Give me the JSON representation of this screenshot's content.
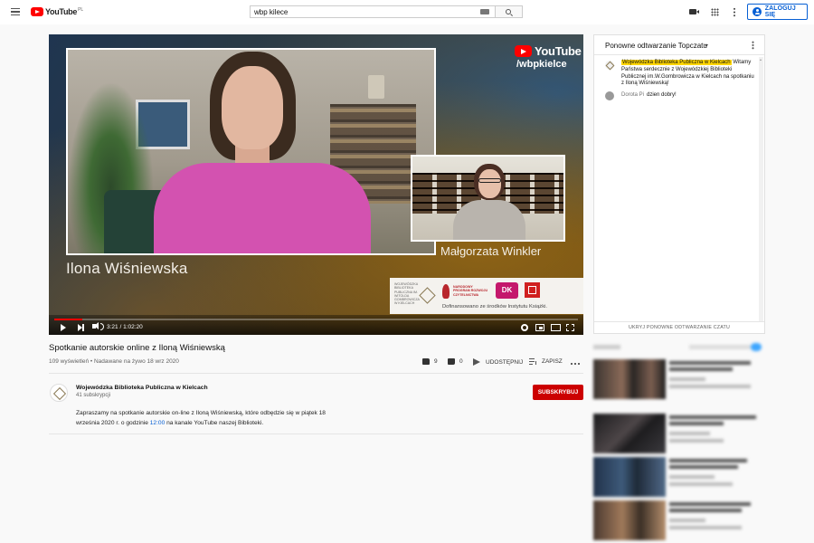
{
  "masthead": {
    "logo_text": "YouTube",
    "logo_region": "PL",
    "search_value": "wbp kilece",
    "signin_label": "ZALOGUJ SIĘ"
  },
  "player": {
    "overlay_brand": "YouTube",
    "overlay_handle": "/wbpkielce",
    "speaker_main": "Ilona Wiśniewska",
    "speaker_inset": "Małgorzata Winkler",
    "sponsor_wbp_text": "WOJEWÓDZKA BIBLIOTEKA PUBLICZNA IM. WITOLDA GOMBROWICZA W KIELCACH",
    "sponsor_npr_text": "NARODOWY PROGRAM ROZWOJU CZYTELNICTWA",
    "sponsor_dk_text": "DK",
    "sponsor_caption": "Dofinansowano ze środków Instytutu Książki.",
    "time_display": "3:21 / 1:02:20",
    "progress_fraction": 0.054
  },
  "video": {
    "title": "Spotkanie autorskie online z Iloną Wiśniewską",
    "meta": "109 wyświetleń • Nadawane na żywo 18 wrz 2020",
    "likes": "9",
    "dislikes": "0",
    "share_label": "UDOSTĘPNIJ",
    "save_label": "ZAPISZ"
  },
  "channel": {
    "name": "Wojewódzka Biblioteka Publiczna w Kielcach",
    "subs": "41 subskrypcji",
    "subscribe_label": "SUBSKRYBUJ",
    "description_before": "Zapraszamy na spotkanie autorskie on-line z Iloną Wiśniewską, które odbędzie się w piątek 18 września 2020 r. o godzinie ",
    "description_link": "12:00",
    "description_after": " na kanale YouTube naszej Biblioteki."
  },
  "chat": {
    "title": "Ponowne odtwarzanie Topczatu",
    "messages": [
      {
        "author": "Wojewódzka Biblioteka Publiczna w Kielcach",
        "text": "Witamy Państwa serdecznie z Wojewódzkiej Biblioteki Publicznej im.W.Gombrowicza w Kielcach na spotkaniu z Iloną Wiśniewską!"
      },
      {
        "author": "Dorota Pi",
        "text": "dzien dobry!"
      }
    ],
    "hide_label": "UKRYJ PONOWNE ODTWARZANIE CZATU"
  },
  "colors": {
    "brand_red": "#ff0000",
    "subscribe_red": "#cc0000",
    "link_blue": "#065fd4",
    "author_highlight": "#ffd600"
  }
}
